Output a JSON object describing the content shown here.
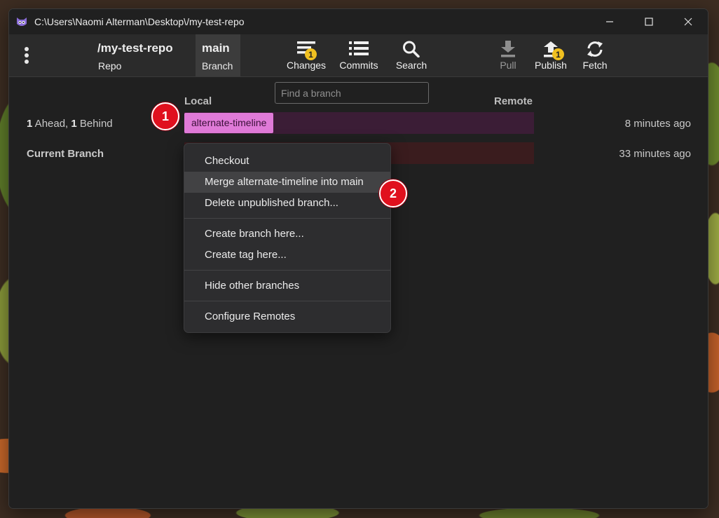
{
  "window": {
    "title": "C:\\Users\\Naomi Alterman\\Desktop\\/my-test-repo",
    "controls": {
      "minimize": "—",
      "maximize": "☐",
      "close": "✕"
    }
  },
  "toolbar": {
    "repo": {
      "title": "/my-test-repo",
      "label": "Repo"
    },
    "branch": {
      "title": "main",
      "label": "Branch"
    },
    "changes": {
      "label": "Changes",
      "badge": "1"
    },
    "commits": {
      "label": "Commits"
    },
    "search": {
      "label": "Search"
    },
    "pull": {
      "label": "Pull"
    },
    "publish": {
      "label": "Publish",
      "badge": "1"
    },
    "fetch": {
      "label": "Fetch"
    }
  },
  "branch_panel": {
    "search_placeholder": "Find a branch",
    "local_header": "Local",
    "remote_header": "Remote",
    "rows": [
      {
        "ahead": "1",
        "ahead_text": " Ahead, ",
        "behind": "1",
        "behind_text": " Behind",
        "branch": "alternate-timeline",
        "time": "8 minutes ago"
      },
      {
        "label": "Current Branch",
        "time": "33 minutes ago"
      }
    ]
  },
  "context_menu": {
    "items": [
      "Checkout",
      "Merge alternate-timeline into main",
      "Delete unpublished branch...",
      "Create branch here...",
      "Create tag here...",
      "Hide other branches",
      "Configure Remotes"
    ]
  },
  "steps": {
    "one": "1",
    "two": "2"
  },
  "colors": {
    "branch_chip": "#e07ad8",
    "lane_local": "#3b1d36",
    "lane_current": "#3a1c1e",
    "badge": "#f0c020",
    "step_marker": "#e0101e"
  }
}
